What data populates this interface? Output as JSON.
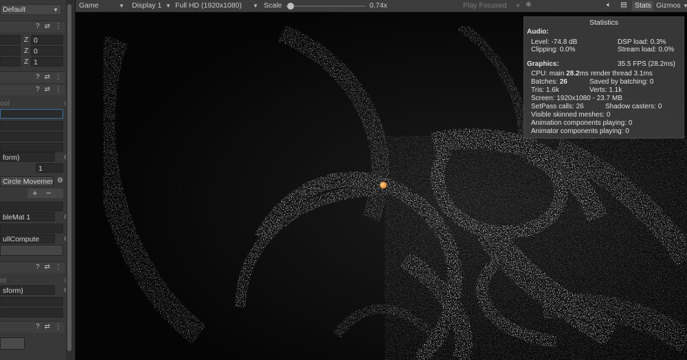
{
  "inspector": {
    "top_dropdown": "Default",
    "position": {
      "z": "0"
    },
    "rotation": {
      "z": "0"
    },
    "scale": {
      "z": "1"
    },
    "faded_label": "ool",
    "transform_ref": "form)",
    "count_value": "1",
    "script_ref": "Circle Movemen",
    "plus": "+",
    "minus": "−",
    "material_ref": "bleMat 1",
    "compute_ref": "ullCompute",
    "faded_label_2": "nt",
    "transform_ref_2": "sform)"
  },
  "toolbar": {
    "game_tab": "Game",
    "display": "Display 1",
    "resolution": "Full HD (1920x1080)",
    "scale_label": "Scale",
    "scale_value": "0.74x",
    "play_focused": "Play Focused",
    "stats": "Stats",
    "gizmos": "Gizmos",
    "scale_level": 0.02
  },
  "stats": {
    "title": "Statistics",
    "audio_header": "Audio:",
    "level": "Level: -74.8 dB",
    "clipping": "Clipping: 0.0%",
    "dsp_load": "DSP load: 0.3%",
    "stream_load": "Stream load: 0.0%",
    "graphics_header": "Graphics:",
    "fps": "35.5 FPS (28.2ms)",
    "cpu_prefix": "CPU: main ",
    "cpu_main": "28.2",
    "cpu_suffix": "ms  render thread 3.1ms",
    "batches_prefix": "Batches: ",
    "batches_value": "26",
    "saved_by_batching": "Saved by batching: 0",
    "tris": "Tris: 1.6k",
    "verts": "Verts: 1.1k",
    "screen": "Screen: 1920x1080 - 23.7 MB",
    "setpass": "SetPass calls: 26",
    "shadow_casters": "Shadow casters: 0",
    "visible_skinned": "Visible skinned meshes: 0",
    "animation_components": "Animation components playing: 0",
    "animator_components": "Animator components playing: 0"
  },
  "colors": {
    "editor_bg": "#383838",
    "toolbar_bg": "#3c3c3c",
    "game_bg": "#050505",
    "particle": "#e8e8e8",
    "orb": "#f0a040"
  }
}
